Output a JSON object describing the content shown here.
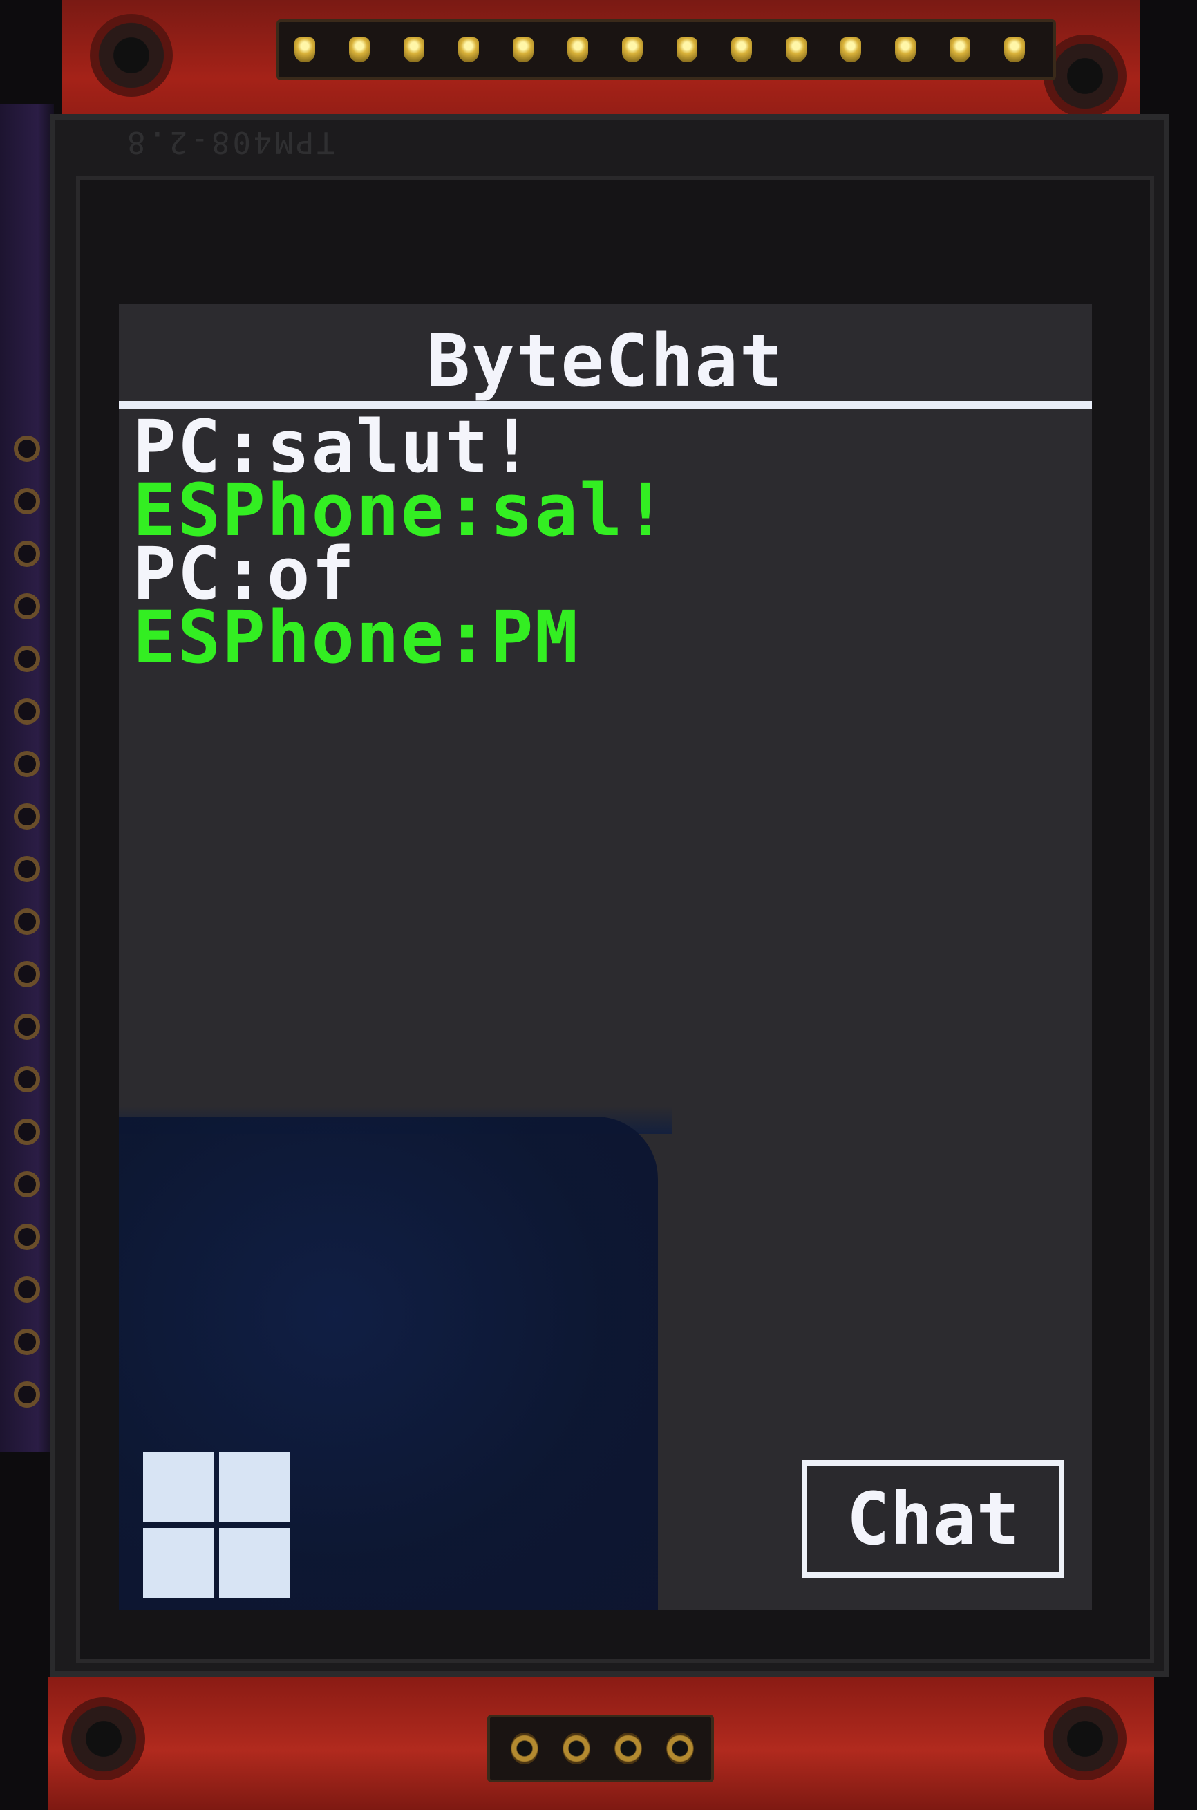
{
  "app": {
    "title": "ByteChat"
  },
  "colors": {
    "pc_text": "#f4f5fb",
    "esphone_text": "#33ee22",
    "screen_bg": "#2c2b2f",
    "divider": "#e9eef8"
  },
  "messages": [
    {
      "sender": "PC",
      "text": "PC:salut!",
      "color": "#f4f5fb"
    },
    {
      "sender": "ESPhone",
      "text": "ESPhone:sal!",
      "color": "#33ee22"
    },
    {
      "sender": "PC",
      "text": "PC:of",
      "color": "#f4f5fb"
    },
    {
      "sender": "ESPhone",
      "text": "ESPhone:PM",
      "color": "#33ee22"
    }
  ],
  "buttons": {
    "chat_label": "Chat",
    "start_icon": "windows-icon"
  }
}
